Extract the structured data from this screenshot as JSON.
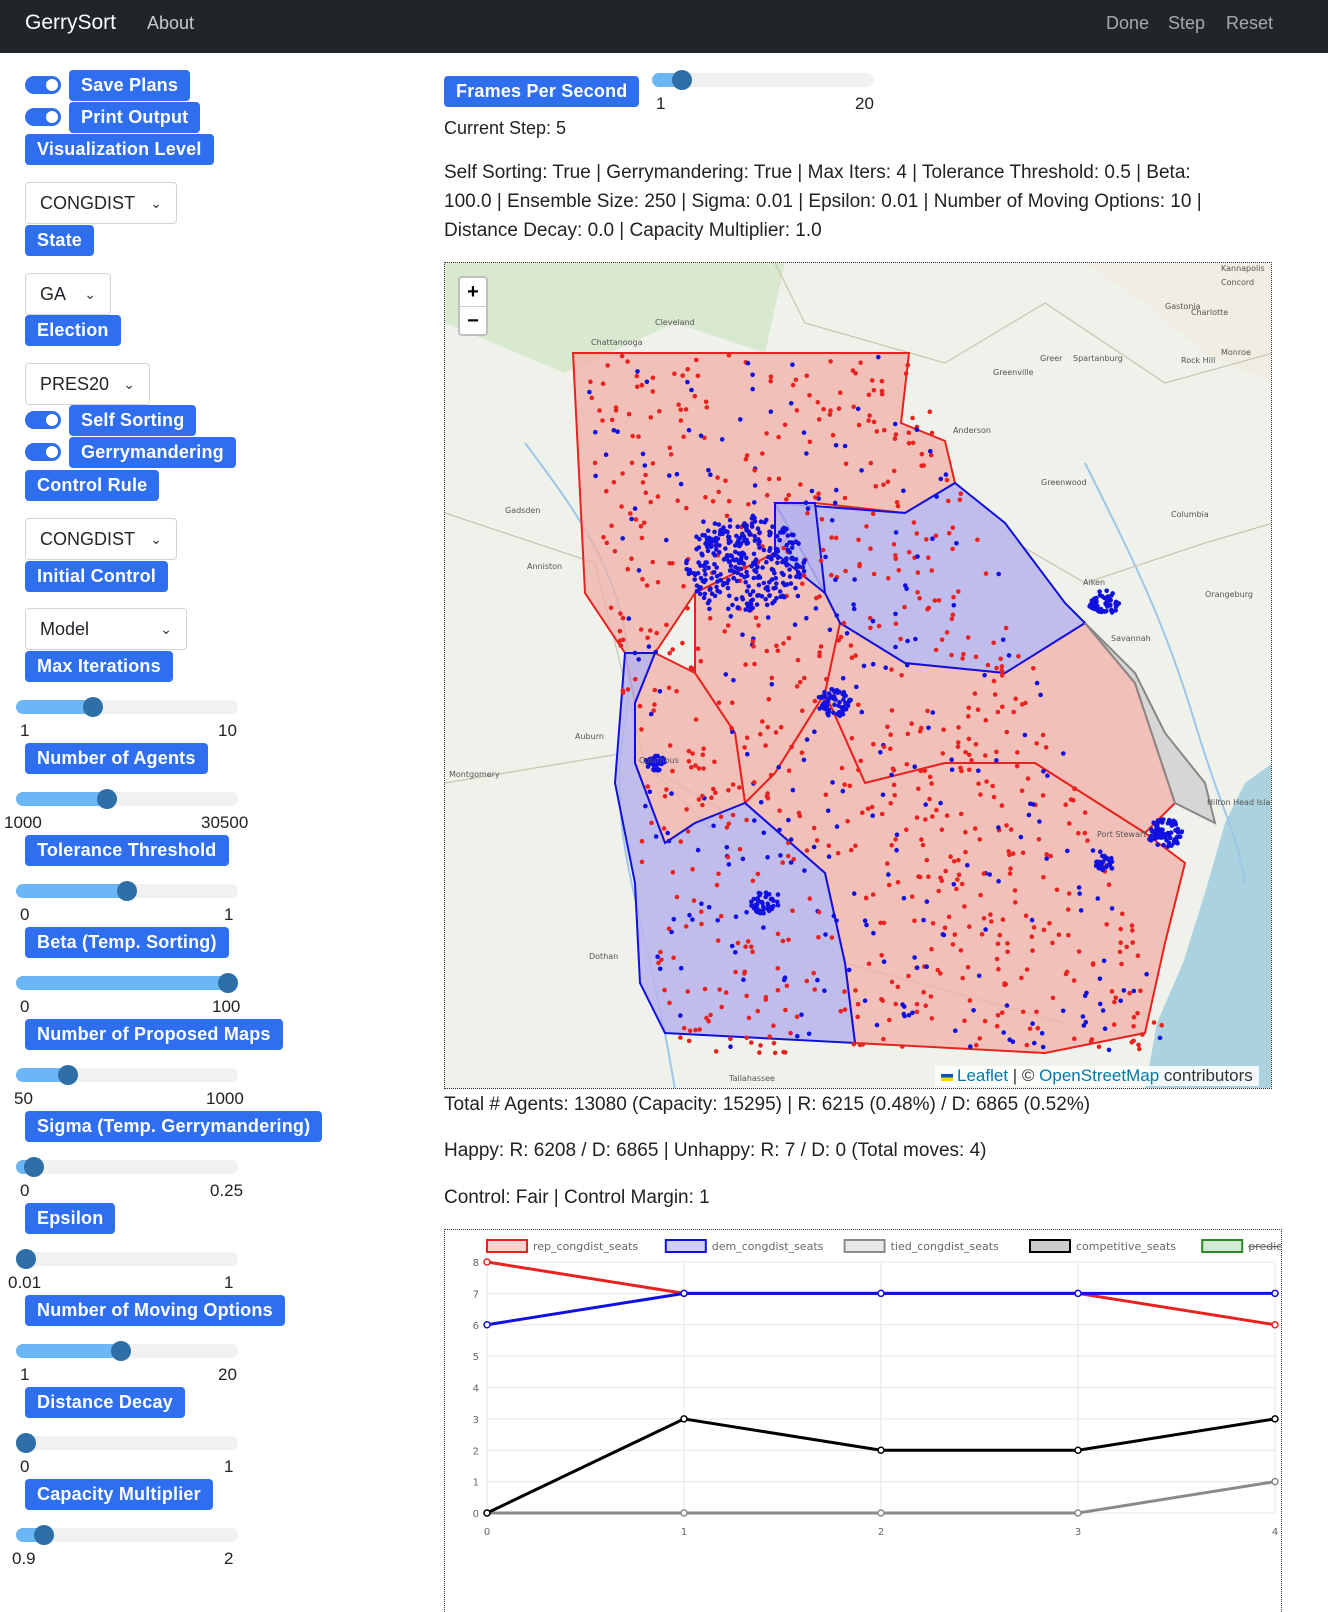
{
  "nav": {
    "brand": "GerrySort",
    "about": "About",
    "done": "Done",
    "step": "Step",
    "reset": "Reset"
  },
  "sidebar": {
    "save_plans": "Save Plans",
    "print_output": "Print Output",
    "visualization_level": "Visualization Level",
    "visualization_level_value": "CONGDIST",
    "state": "State",
    "state_value": "GA",
    "election": "Election",
    "election_value": "PRES20",
    "self_sorting": "Self Sorting",
    "gerrymandering": "Gerrymandering",
    "control_rule": "Control Rule",
    "control_rule_value": "CONGDIST",
    "initial_control": "Initial Control",
    "initial_control_value": "Model",
    "sliders": [
      {
        "label": "Max Iterations",
        "min": "1",
        "max": "10",
        "fraction": 0.33
      },
      {
        "label": "Number of Agents",
        "min": "1000",
        "max": "30500",
        "fraction": 0.4
      },
      {
        "label": "Tolerance Threshold",
        "min": "0",
        "max": "1",
        "fraction": 0.5
      },
      {
        "label": "Beta (Temp. Sorting)",
        "min": "0",
        "max": "100",
        "fraction": 1.0
      },
      {
        "label": "Number of Proposed Maps",
        "min": "50",
        "max": "1000",
        "fraction": 0.21
      },
      {
        "label": "Sigma (Temp. Gerrymandering)",
        "min": "0",
        "max": "0.25",
        "fraction": 0.04
      },
      {
        "label": "Epsilon",
        "min": "0.01",
        "max": "1",
        "fraction": 0.0
      },
      {
        "label": "Number of Moving Options",
        "min": "1",
        "max": "20",
        "fraction": 0.47
      },
      {
        "label": "Distance Decay",
        "min": "0",
        "max": "1",
        "fraction": 0.0
      },
      {
        "label": "Capacity Multiplier",
        "min": "0.9",
        "max": "2",
        "fraction": 0.09
      }
    ]
  },
  "main": {
    "fps_label": "Frames Per Second",
    "fps_min": "1",
    "fps_max": "20",
    "fps_fraction": 0.1,
    "current_step": "Current Step: 5",
    "params_line1": "Self Sorting: True | Gerrymandering: True | Max Iters: 4 | Tolerance Threshold: 0.5 | Beta:",
    "params_line2": "100.0 | Ensemble Size: 250 | Sigma: 0.01 | Epsilon: 0.01 | Number of Moving Options: 10 |",
    "params_line3": "Distance Decay: 0.0 | Capacity Multiplier: 1.0",
    "stats_agents": "Total # Agents: 13080 (Capacity: 15295) | R: 6215 (0.48%) / D: 6865 (0.52%)",
    "stats_happy": "Happy: R: 6208 / D: 6865 | Unhappy: R: 7 / D: 0 (Total moves: 4)",
    "stats_control": "Control: Fair | Control Margin: 1"
  },
  "map": {
    "zoom_in": "+",
    "zoom_out": "−",
    "attribution_leaflet": "Leaflet",
    "attribution_sep": " | © ",
    "attribution_osm": "OpenStreetMap",
    "attribution_tail": " contributors",
    "places": [
      "Chattanooga",
      "Cleveland",
      "Charlotte",
      "Concord",
      "Kannapolis",
      "Gastonia",
      "Greenville",
      "Greer",
      "Spartanburg",
      "Anderson",
      "Greenwood",
      "Columbia",
      "Aiken",
      "Orangeburg",
      "Gadsden",
      "Anniston",
      "Auburn",
      "Montgomery",
      "Columbus",
      "Dothan",
      "Tallahassee",
      "Savannah",
      "Hilton Head Island",
      "Port Stewart",
      "Rock Hill",
      "Monroe"
    ],
    "colors": {
      "rep": "#e8231f",
      "dem": "#1010e0",
      "rep_fill": "#f2b0a8",
      "dem_fill": "#b7b4ec"
    }
  },
  "chart_data": {
    "type": "line",
    "x": [
      0,
      1,
      2,
      3,
      4
    ],
    "ylim": [
      0,
      8
    ],
    "yticks": [
      0,
      1,
      2,
      3,
      4,
      5,
      6,
      7,
      8
    ],
    "series": [
      {
        "name": "rep_congdist_seats",
        "color": "#e8231f",
        "values": [
          8,
          7,
          7,
          7,
          6
        ]
      },
      {
        "name": "dem_congdist_seats",
        "color": "#1010e0",
        "values": [
          6,
          7,
          7,
          7,
          7
        ]
      },
      {
        "name": "tied_congdist_seats",
        "color": "#8a8a8a",
        "values": [
          0,
          0,
          0,
          0,
          1
        ]
      },
      {
        "name": "competitive_seats",
        "color": "#000000",
        "values": [
          0,
          3,
          2,
          2,
          3
        ]
      },
      {
        "name": "predicted_seats",
        "color": "#2a8a2a",
        "values": [],
        "hidden": true
      }
    ]
  }
}
